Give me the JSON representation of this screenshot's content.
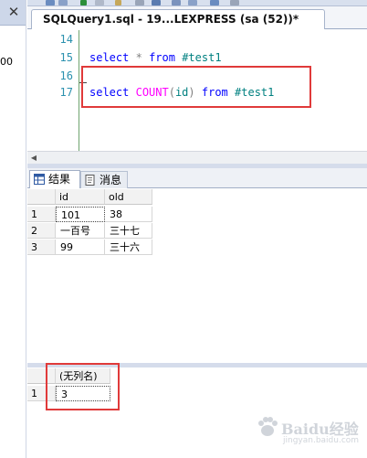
{
  "left_panel": {
    "fragment_text": "00"
  },
  "document_tab": {
    "title": "SQLQuery1.sql - 19...LEXPRESS (sa (52))*"
  },
  "editor": {
    "lines": [
      {
        "number": "14",
        "code": ""
      },
      {
        "number": "15",
        "code": "select * from #test1"
      },
      {
        "number": "16",
        "code": ""
      },
      {
        "number": "17",
        "code": "select COUNT(id) from #test1"
      }
    ]
  },
  "results_tabs": {
    "results_label": "结果",
    "messages_label": "消息"
  },
  "result_grid_1": {
    "columns": [
      "id",
      "old"
    ],
    "rows": [
      {
        "row_number": "1",
        "cells": [
          "101",
          "38"
        ]
      },
      {
        "row_number": "2",
        "cells": [
          "一百号",
          "三十七"
        ]
      },
      {
        "row_number": "3",
        "cells": [
          "99",
          "三十六"
        ]
      }
    ]
  },
  "result_grid_2": {
    "columns": [
      "(无列名)"
    ],
    "rows": [
      {
        "row_number": "1",
        "cells": [
          "3"
        ]
      }
    ]
  },
  "watermark": {
    "text": "Baidu经验",
    "subtext": "jingyan.baidu.com"
  },
  "colors": {
    "highlight_box": "#e03a3a",
    "keyword": "#0000ff",
    "function": "#ff00ff",
    "identifier": "#008080",
    "line_number": "#2b91af"
  }
}
